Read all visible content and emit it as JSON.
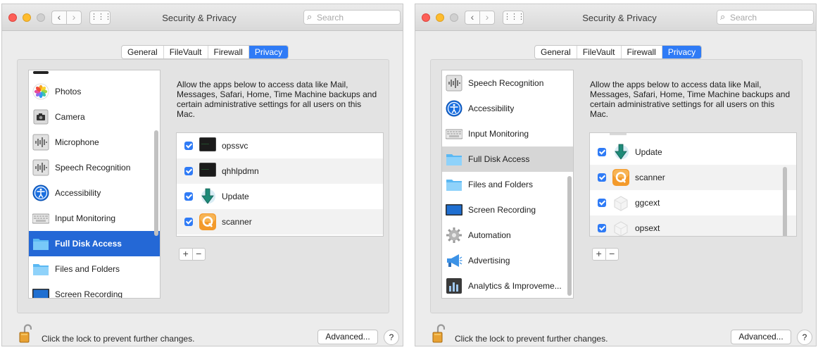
{
  "windows": [
    {
      "title": "Security & Privacy",
      "search_placeholder": "Search",
      "tabs": [
        "General",
        "FileVault",
        "Firewall",
        "Privacy"
      ],
      "active_tab": "Privacy",
      "sidebar_items": [
        {
          "label": "Photos",
          "icon": "photos-icon",
          "selected": false
        },
        {
          "label": "Camera",
          "icon": "camera-icon",
          "selected": false
        },
        {
          "label": "Microphone",
          "icon": "microphone-icon",
          "selected": false
        },
        {
          "label": "Speech Recognition",
          "icon": "speech-recognition-icon",
          "selected": false
        },
        {
          "label": "Accessibility",
          "icon": "accessibility-icon",
          "selected": false
        },
        {
          "label": "Input Monitoring",
          "icon": "keyboard-icon",
          "selected": false
        },
        {
          "label": "Full Disk Access",
          "icon": "folder-icon",
          "selected": true
        },
        {
          "label": "Files and Folders",
          "icon": "folder-icon",
          "selected": false
        },
        {
          "label": "Screen Recording",
          "icon": "screen-recording-icon",
          "selected": false
        }
      ],
      "description": "Allow the apps below to access data like Mail, Messages, Safari, Home, Time Machine backups and certain administrative settings for all users on this Mac.",
      "apps": [
        {
          "name": "opssvc",
          "checked": true,
          "icon": "terminal-icon"
        },
        {
          "name": "qhhlpdmn",
          "checked": true,
          "icon": "terminal-icon"
        },
        {
          "name": "Update",
          "checked": true,
          "icon": "download-arrow-icon"
        },
        {
          "name": "scanner",
          "checked": true,
          "icon": "scanner-app-icon"
        }
      ],
      "lock_text": "Click the lock to prevent further changes.",
      "advanced_label": "Advanced...",
      "help_label": "?",
      "add_label": "+",
      "remove_label": "−"
    },
    {
      "title": "Security & Privacy",
      "search_placeholder": "Search",
      "tabs": [
        "General",
        "FileVault",
        "Firewall",
        "Privacy"
      ],
      "active_tab": "Privacy",
      "sidebar_items": [
        {
          "label": "Speech Recognition",
          "icon": "speech-recognition-icon",
          "selected": false
        },
        {
          "label": "Accessibility",
          "icon": "accessibility-icon",
          "selected": false
        },
        {
          "label": "Input Monitoring",
          "icon": "keyboard-icon",
          "selected": false
        },
        {
          "label": "Full Disk Access",
          "icon": "folder-icon",
          "selected": true
        },
        {
          "label": "Files and Folders",
          "icon": "folder-icon",
          "selected": false
        },
        {
          "label": "Screen Recording",
          "icon": "screen-recording-icon",
          "selected": false
        },
        {
          "label": "Automation",
          "icon": "gear-icon",
          "selected": false
        },
        {
          "label": "Advertising",
          "icon": "megaphone-icon",
          "selected": false
        },
        {
          "label": "Analytics & Improveme...",
          "icon": "analytics-icon",
          "selected": false
        }
      ],
      "description": "Allow the apps below to access data like Mail, Messages, Safari, Home, Time Machine backups and certain administrative settings for all users on this Mac.",
      "apps": [
        {
          "name": "Update",
          "checked": true,
          "icon": "download-arrow-icon"
        },
        {
          "name": "scanner",
          "checked": true,
          "icon": "scanner-app-icon"
        },
        {
          "name": "ggcext",
          "checked": true,
          "icon": "extension-icon"
        },
        {
          "name": "opsext",
          "checked": true,
          "icon": "extension-icon"
        }
      ],
      "lock_text": "Click the lock to prevent further changes.",
      "advanced_label": "Advanced...",
      "help_label": "?",
      "add_label": "+",
      "remove_label": "−"
    }
  ],
  "colors": {
    "accent": "#2f7bf6",
    "selection": "#2468d6",
    "window_bg": "#ececec"
  }
}
